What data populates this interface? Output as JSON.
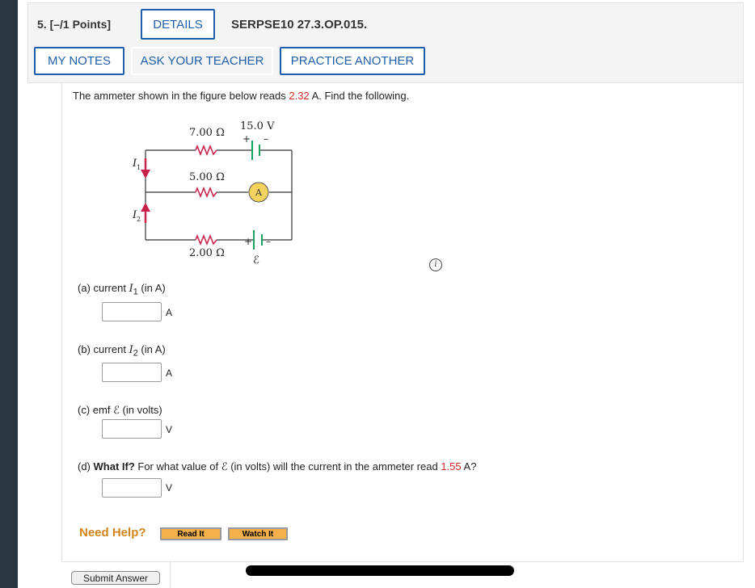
{
  "header": {
    "question_number": "5.",
    "points": "[–/1 Points]",
    "details_label": "DETAILS",
    "question_id": "SERPSE10 27.3.OP.015.",
    "my_notes_label": "MY NOTES",
    "ask_teacher_label": "ASK YOUR TEACHER",
    "practice_another_label": "PRACTICE ANOTHER"
  },
  "problem": {
    "text_before": "The ammeter shown in the figure below reads ",
    "reading": "2.32",
    "text_after": " A. Find the following."
  },
  "circuit": {
    "r_top": "7.00 Ω",
    "r_mid": "5.00 Ω",
    "r_bottom": "2.00 Ω",
    "battery_top": "15.0 V",
    "ammeter": "A",
    "emf_symbol": "ℰ",
    "current1": "I",
    "current1_sub": "1",
    "current2": "I",
    "current2_sub": "2",
    "plus": "+",
    "minus": "–",
    "colors": {
      "arrow": "#c8234e",
      "battery": "#1aa35c",
      "ammeter": "#f3d35e",
      "resistor": "#c8234e"
    }
  },
  "parts": {
    "a": {
      "prefix": "(a)  current ",
      "var": "I",
      "sub": "1",
      "suffix": " (in A)",
      "unit": "A",
      "value": ""
    },
    "b": {
      "prefix": "(b)  current ",
      "var": "I",
      "sub": "2",
      "suffix": " (in A)",
      "unit": "A",
      "value": ""
    },
    "c": {
      "prefix": "(c)  emf ",
      "var": "ℰ",
      "suffix": " (in volts)",
      "unit": "V",
      "value": ""
    },
    "d": {
      "prefix": "(d)  ",
      "bold": "What If?",
      "text_mid": " For what value of ",
      "var": "ℰ",
      "text_after": " (in volts) will the current in the ammeter read ",
      "value_red": "1.55",
      "suffix": " A?",
      "unit": "V",
      "value": ""
    }
  },
  "help": {
    "need_help": "Need Help?",
    "read_it": "Read It",
    "watch_it": "Watch It"
  },
  "submit_label": "Submit Answer",
  "info_icon": "i"
}
